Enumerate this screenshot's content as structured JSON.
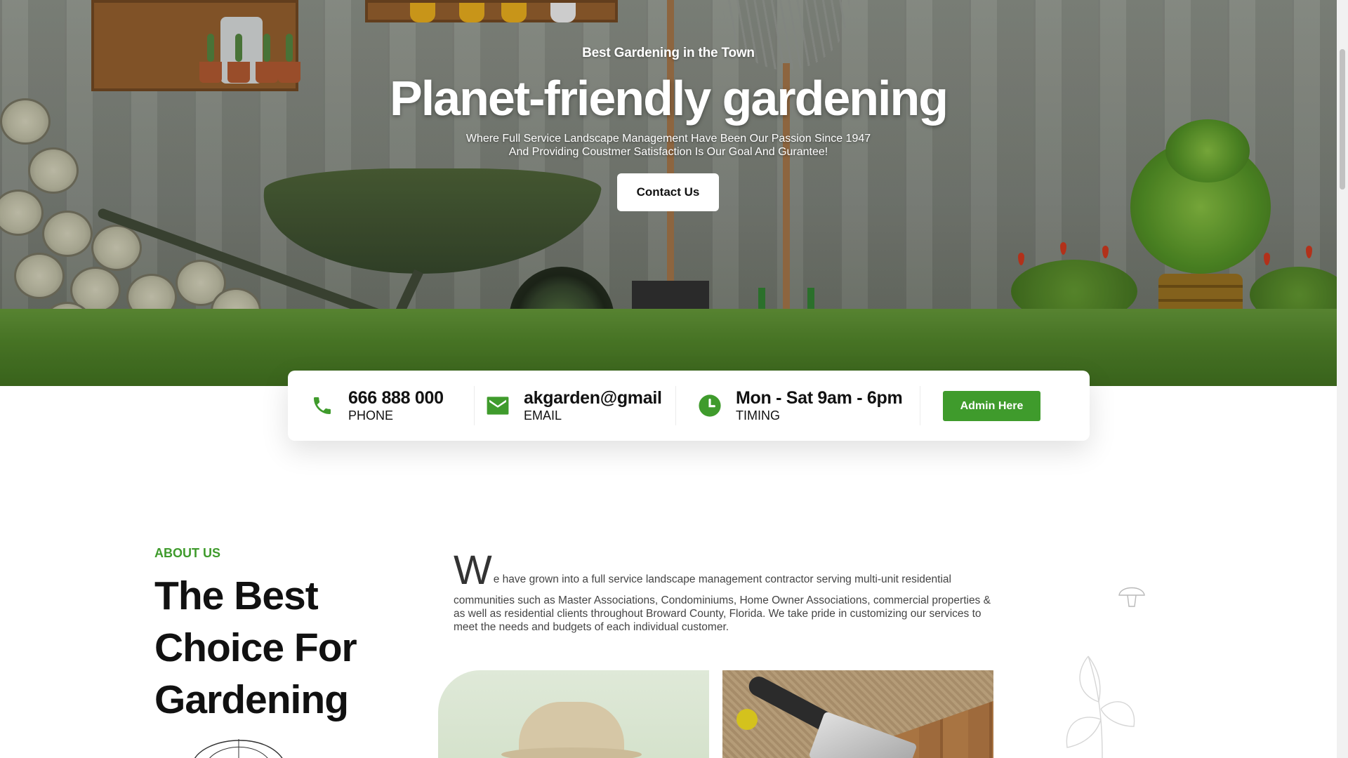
{
  "hero": {
    "eyebrow": "Best Gardening in the Town",
    "headline": "Planet-friendly gardening",
    "subtitle_line1": "Where Full Service Landscape Management Have Been Our Passion Since 1947",
    "subtitle_line2": "And Providing Coustmer Satisfaction Is Our Goal And Gurantee!",
    "cta_label": "Contact Us"
  },
  "info_bar": {
    "phone": {
      "value": "666 888 000",
      "label": "PHONE",
      "icon": "phone-icon"
    },
    "email": {
      "value": "akgarden@gmail",
      "label": "EMAIL",
      "icon": "mail-icon"
    },
    "timing": {
      "value": "Mon - Sat 9am - 6pm",
      "label": "TIMING",
      "icon": "clock-icon"
    },
    "admin_label": "Admin Here"
  },
  "about": {
    "eyebrow": "ABOUT US",
    "title_line1": "The Best",
    "title_line2": "Choice For",
    "title_line3": "Gardening",
    "dropcap": "W",
    "body_first": "e have grown into a full service landscape management contractor serving multi-unit residential",
    "body_rest": "communities such as Master Associations, Condominiums, Home Owner Associations, commercial properties & as well as residential clients throughout Broward County, Florida. We take pride in customizing our services to meet the needs and budgets of each individual customer."
  },
  "colors": {
    "accent_green": "#3f9b2c",
    "text_dark": "#111111",
    "body_gray": "#444444"
  }
}
